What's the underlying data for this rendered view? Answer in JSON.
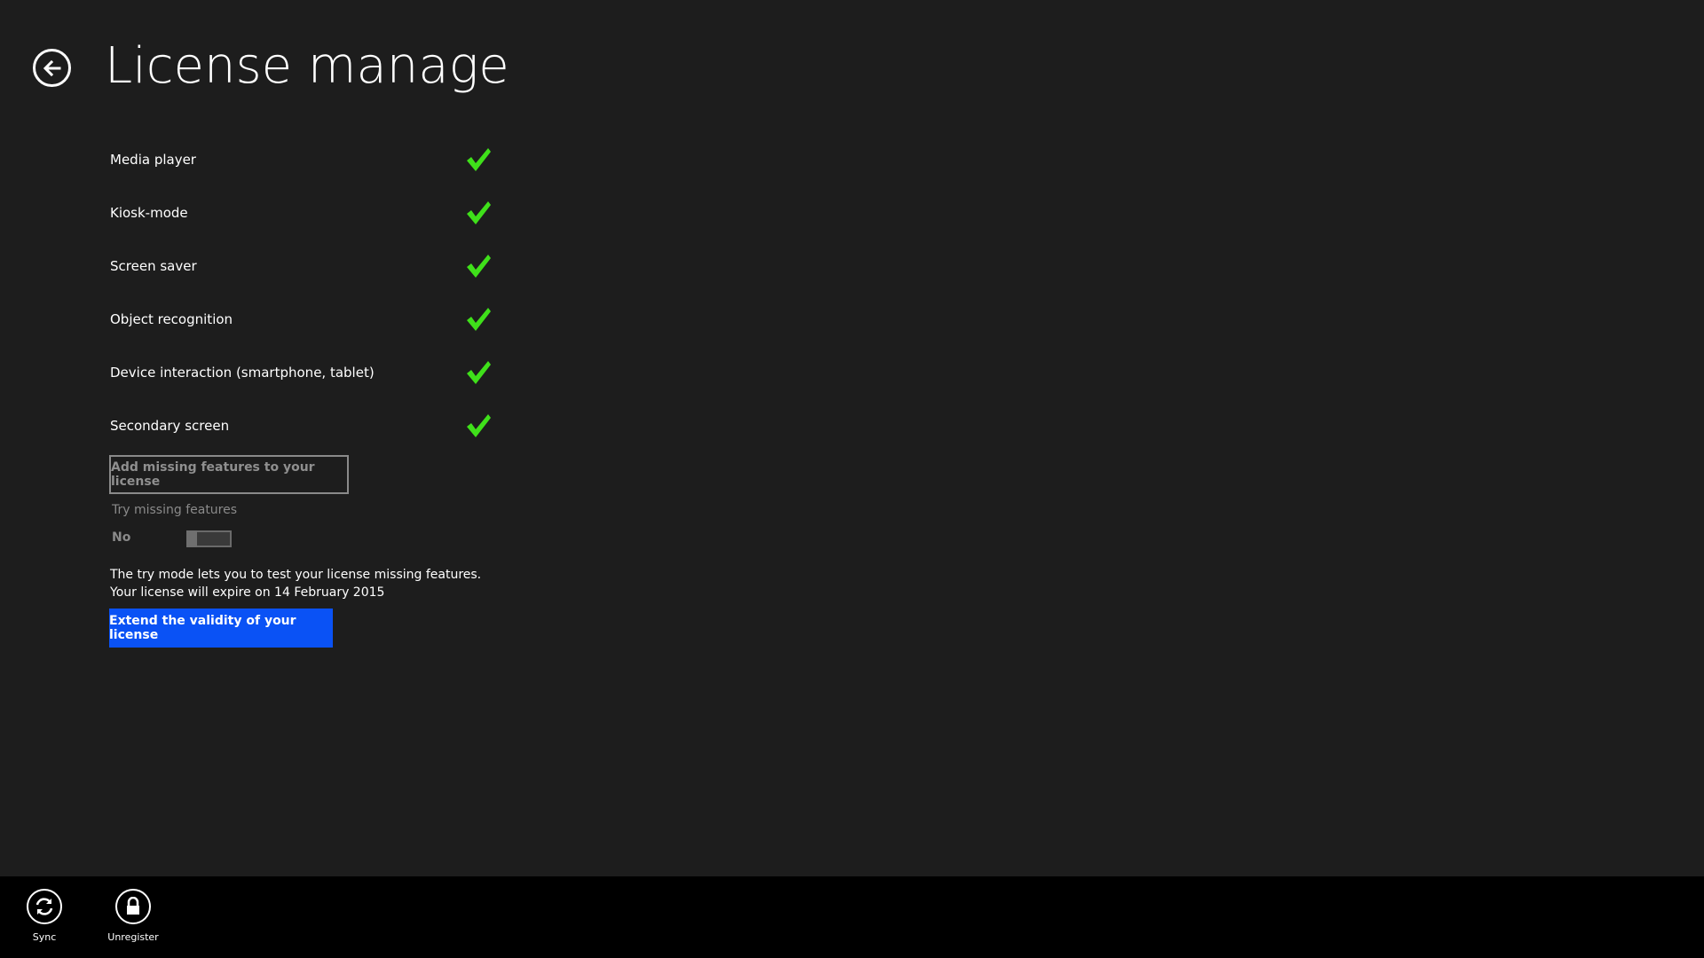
{
  "header": {
    "title": "License manage",
    "back_icon": "back-arrow-icon"
  },
  "features": [
    {
      "label": "Media player",
      "enabled": true,
      "icon": "check-icon"
    },
    {
      "label": "Kiosk-mode",
      "enabled": true,
      "icon": "check-icon"
    },
    {
      "label": "Screen saver",
      "enabled": true,
      "icon": "check-icon"
    },
    {
      "label": "Object recognition",
      "enabled": true,
      "icon": "check-icon"
    },
    {
      "label": "Device interaction (smartphone, tablet)",
      "enabled": true,
      "icon": "check-icon"
    },
    {
      "label": "Secondary screen",
      "enabled": true,
      "icon": "check-icon"
    }
  ],
  "add_features": {
    "label": "Add missing features to your license"
  },
  "try_mode": {
    "label": "Try missing features",
    "state": "No",
    "on": false
  },
  "info": {
    "line1": "The try mode lets you to test your license missing features.",
    "line2": "Your license will expire on 14 February 2015"
  },
  "extend": {
    "label": "Extend the validity of your license"
  },
  "app_bar": {
    "items": [
      {
        "label": "Sync",
        "icon": "sync-icon"
      },
      {
        "label": "Unregister",
        "icon": "lock-icon"
      }
    ]
  },
  "colors": {
    "background": "#1d1d1d",
    "check": "#3fe01a",
    "accent": "#0a52f5",
    "app_bar": "#000000",
    "muted": "#8a8a8a"
  }
}
